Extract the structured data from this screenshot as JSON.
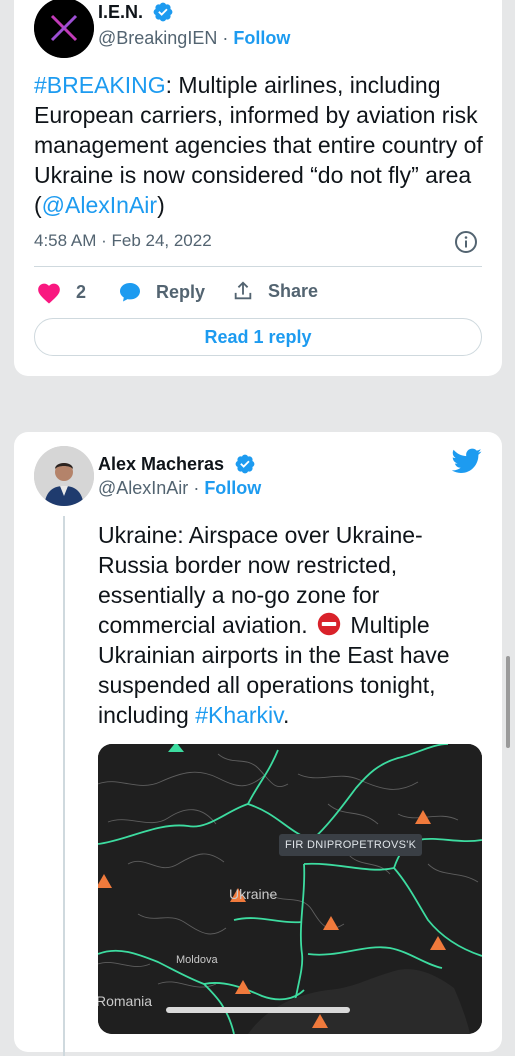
{
  "tweet1": {
    "display_name": "I.E.N.",
    "handle": "@BreakingIEN",
    "separator": " · ",
    "follow_label": "Follow",
    "hashtag": "#BREAKING",
    "text_part1": ": Multiple airlines, including European carriers, informed by aviation risk management agencies that entire country of Ukraine is now considered “do not fly” area (",
    "mention": "@AlexInAir",
    "text_part2": ")",
    "timestamp": "4:58 AM · Feb 24, 2022",
    "like_count": "2",
    "reply_label": "Reply",
    "share_label": "Share",
    "read_replies_label": "Read 1 reply"
  },
  "tweet2": {
    "display_name": "Alex Macheras",
    "handle": "@AlexInAir",
    "separator": " · ",
    "follow_label": "Follow",
    "text_part1": "Ukraine: Airspace over Ukraine-Russia border now restricted, essentially a no-go zone for commercial aviation. ",
    "text_part2": " Multiple Ukrainian airports in the East have suspended all operations tonight, including ",
    "hashtag": "#Kharkiv",
    "text_part3": "."
  },
  "map": {
    "fir_label": "FIR DNIPROPETROVS'K",
    "country_label": "Ukraine",
    "moldova_label": "Moldova",
    "romania_label": "Romania"
  },
  "icons": {
    "verified": "verified-badge-icon",
    "info": "info-icon",
    "heart": "heart-icon",
    "reply": "reply-bubble-icon",
    "share": "share-icon",
    "twitter": "twitter-bird-icon",
    "no_entry": "no-entry-emoji",
    "warning": "warning-triangle-icon"
  },
  "colors": {
    "link": "#1d9bf0",
    "heart": "#f91880",
    "map_background": "#1f1f1f",
    "map_borders": "#3ddca0",
    "warning": "#f07a3c"
  }
}
